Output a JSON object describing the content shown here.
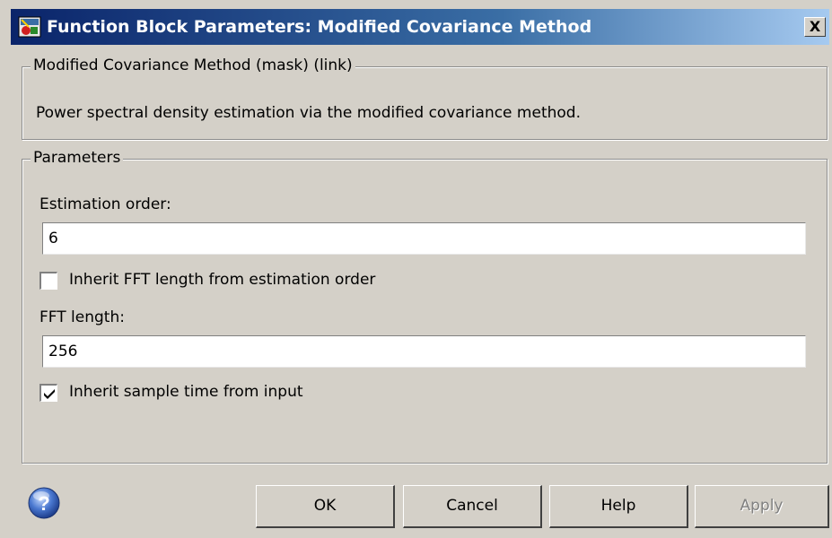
{
  "window": {
    "title": "Function Block Parameters: Modified Covariance Method",
    "close_label": "X"
  },
  "mask_group": {
    "legend": "Modified Covariance Method (mask) (link)",
    "description": "Power spectral density estimation via the modified covariance method."
  },
  "parameters": {
    "legend": "Parameters",
    "estimation_order_label": "Estimation order:",
    "estimation_order_value": "6",
    "inherit_fft_label": "Inherit FFT length from estimation order",
    "inherit_fft_checked": false,
    "fft_length_label": "FFT length:",
    "fft_length_value": "256",
    "inherit_sample_time_label": "Inherit sample time from input",
    "inherit_sample_time_checked": true
  },
  "buttons": {
    "ok": "OK",
    "cancel": "Cancel",
    "help": "Help",
    "apply": "Apply"
  },
  "icons": {
    "window": "simulink-block-icon",
    "help": "help-question-icon"
  },
  "colors": {
    "titlebar_start": "#0a246a",
    "titlebar_end": "#a6caf0",
    "dialog_bg": "#d4d0c8"
  }
}
